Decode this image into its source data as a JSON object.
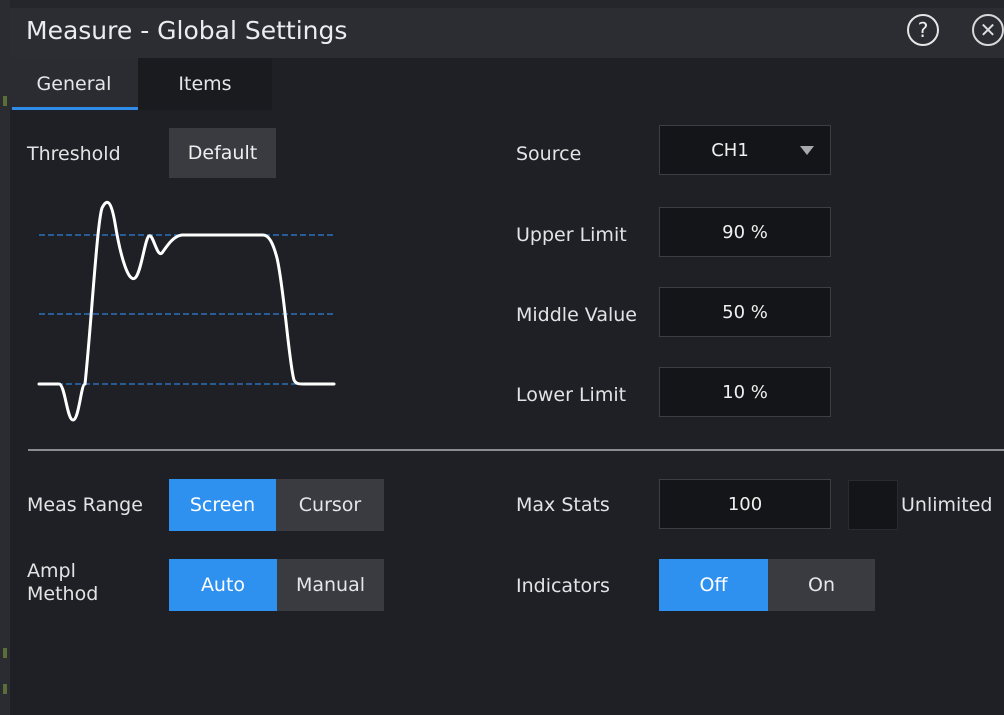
{
  "window": {
    "title": "Measure - Global Settings"
  },
  "title_bar_icons": [
    "help-icon",
    "close-icon"
  ],
  "tabs": [
    {
      "label": "General",
      "active": true
    },
    {
      "label": "Items",
      "active": false
    }
  ],
  "threshold": {
    "label": "Threshold",
    "default_button": "Default"
  },
  "source": {
    "label": "Source",
    "value": "CH1"
  },
  "upper_limit": {
    "label": "Upper Limit",
    "value": "90 %"
  },
  "middle_value": {
    "label": "Middle Value",
    "value": "50 %"
  },
  "lower_limit": {
    "label": "Lower Limit",
    "value": "10 %"
  },
  "meas_range": {
    "label": "Meas Range",
    "options": [
      "Screen",
      "Cursor"
    ],
    "selected": "Screen"
  },
  "ampl_method": {
    "label_line1": "Ampl",
    "label_line2": "Method",
    "options": [
      "Auto",
      "Manual"
    ],
    "selected": "Auto"
  },
  "max_stats": {
    "label": "Max Stats",
    "value": "100",
    "unlimited_label": "Unlimited",
    "unlimited_checked": false
  },
  "indicators": {
    "label": "Indicators",
    "options": [
      "Off",
      "On"
    ],
    "selected": "Off"
  },
  "colors": {
    "accent": "#2e90ef",
    "threshold_line": "#2f7fd8",
    "background": "#1f2025"
  }
}
